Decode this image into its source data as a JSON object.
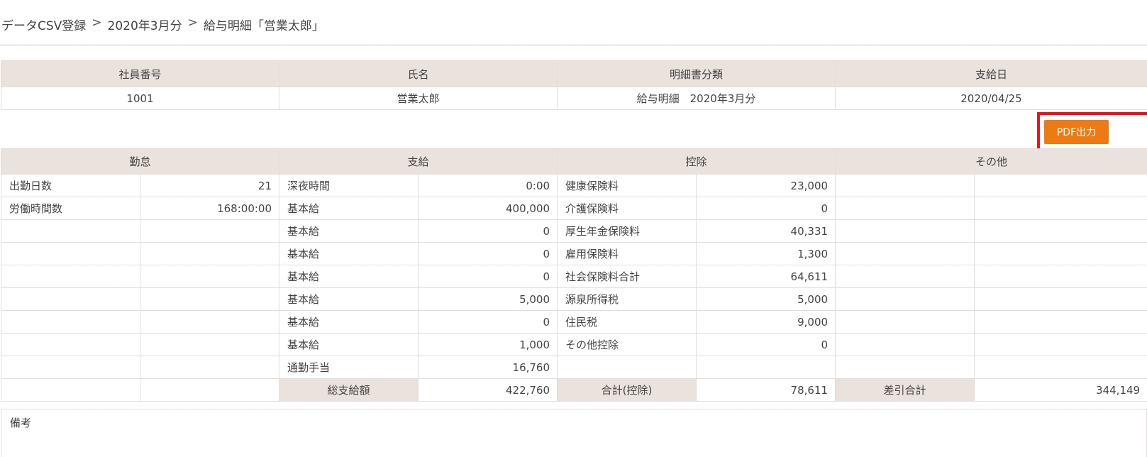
{
  "breadcrumb": {
    "items": [
      "データCSV登録",
      "2020年3月分",
      "給与明細「営業太郎」"
    ],
    "separator": ">"
  },
  "info": {
    "headers": [
      "社員番号",
      "氏名",
      "明細書分類",
      "支給日"
    ],
    "values": [
      "1001",
      "営業太郎",
      "給与明細　2020年3月分",
      "2020/04/25"
    ]
  },
  "pdf_button_label": "PDF出力",
  "sections": {
    "attendance": "勤怠",
    "payment": "支給",
    "deduction": "控除",
    "other": "その他"
  },
  "rows": [
    {
      "att_label": "出勤日数",
      "att_value": "21",
      "pay_label": "深夜時間",
      "pay_value": "0:00",
      "ded_label": "健康保険料",
      "ded_value": "23,000",
      "oth_label": "",
      "oth_value": ""
    },
    {
      "att_label": "労働時間数",
      "att_value": "168:00:00",
      "pay_label": "基本給",
      "pay_value": "400,000",
      "ded_label": "介護保険料",
      "ded_value": "0",
      "oth_label": "",
      "oth_value": ""
    },
    {
      "att_label": "",
      "att_value": "",
      "pay_label": "基本給",
      "pay_value": "0",
      "ded_label": "厚生年金保険料",
      "ded_value": "40,331",
      "oth_label": "",
      "oth_value": ""
    },
    {
      "att_label": "",
      "att_value": "",
      "pay_label": "基本給",
      "pay_value": "0",
      "ded_label": "雇用保険料",
      "ded_value": "1,300",
      "oth_label": "",
      "oth_value": ""
    },
    {
      "att_label": "",
      "att_value": "",
      "pay_label": "基本給",
      "pay_value": "0",
      "ded_label": "社会保険料合計",
      "ded_value": "64,611",
      "oth_label": "",
      "oth_value": ""
    },
    {
      "att_label": "",
      "att_value": "",
      "pay_label": "基本給",
      "pay_value": "5,000",
      "ded_label": "源泉所得税",
      "ded_value": "5,000",
      "oth_label": "",
      "oth_value": ""
    },
    {
      "att_label": "",
      "att_value": "",
      "pay_label": "基本給",
      "pay_value": "0",
      "ded_label": "住民税",
      "ded_value": "9,000",
      "oth_label": "",
      "oth_value": ""
    },
    {
      "att_label": "",
      "att_value": "",
      "pay_label": "基本給",
      "pay_value": "1,000",
      "ded_label": "その他控除",
      "ded_value": "0",
      "oth_label": "",
      "oth_value": ""
    },
    {
      "att_label": "",
      "att_value": "",
      "pay_label": "通勤手当",
      "pay_value": "16,760",
      "ded_label": "",
      "ded_value": "",
      "oth_label": "",
      "oth_value": ""
    }
  ],
  "totals": {
    "gross_label": "総支給額",
    "gross_value": "422,760",
    "deduction_label": "合計(控除)",
    "deduction_value": "78,611",
    "net_label": "差引合計",
    "net_value": "344,149"
  },
  "remarks_label": "備考",
  "colors": {
    "header_bg": "#e9e2dd",
    "pdf_button": "#ee7a14",
    "highlight_frame": "#e8141f"
  }
}
